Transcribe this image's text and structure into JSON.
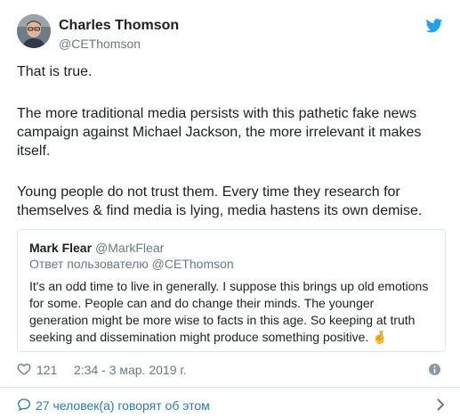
{
  "tweet": {
    "author_name": "Charles Thomson",
    "author_handle": "@CEThomson",
    "paragraphs": [
      "That is true.",
      "The more traditional media persists with this pathetic fake news campaign against Michael Jackson, the more irrelevant it makes itself.",
      "Young people do not trust them. Every time they research for themselves & find media is lying, media hastens its own demise."
    ]
  },
  "quoted": {
    "author_name": "Mark Flear",
    "author_handle": "@MarkFlear",
    "reply_to": "Ответ пользователю @CEThomson",
    "text": "It's an odd time to live in generally. I suppose this brings up old emotions for some. People can and do change their minds. The younger generation might be more wise to facts in this age. So keeping at truth seeking and dissemination might produce something positive.",
    "emoji": "🤞"
  },
  "meta": {
    "likes": "121",
    "date": "2:34 - 3 мар. 2019 г."
  },
  "footer": {
    "people_talking": "27 человек(а) говорят об этом"
  },
  "icons": {
    "brand": "twitter-bird-icon",
    "like": "heart-icon",
    "info": "info-icon",
    "people": "chat-bubble-icon",
    "more": "chevron-right-icon"
  },
  "colors": {
    "twitter_blue": "#1da1f2",
    "link_blue": "#2b7bb9",
    "muted": "#697882",
    "border": "#e1e8ed"
  }
}
